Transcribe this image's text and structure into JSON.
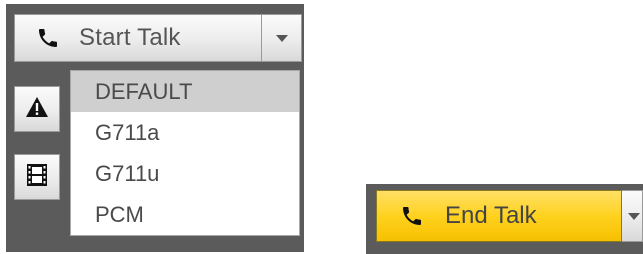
{
  "talk_button": {
    "label": "Start Talk",
    "icon": "phone-icon"
  },
  "codec_dropdown": {
    "options": [
      "DEFAULT",
      "G711a",
      "G711u",
      "PCM"
    ],
    "selected": "DEFAULT"
  },
  "side_buttons": {
    "alarm_icon": "warning-icon",
    "record_icon": "film-icon"
  },
  "end_talk_button": {
    "label": "End Talk",
    "icon": "phone-icon"
  },
  "colors": {
    "panel_bg": "#5b5b5b",
    "button_gray": "#ececec",
    "active_yellow": "#ffd21f",
    "selected_item": "#cfcfcf"
  }
}
